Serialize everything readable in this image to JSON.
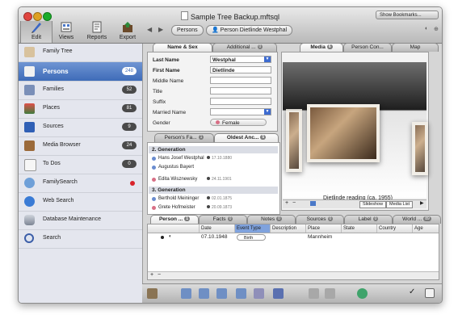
{
  "window": {
    "title": "Sample Tree Backup.mftsql",
    "show_bookmarks": "Show Bookmarks..."
  },
  "toolbar": [
    {
      "label": "Edit",
      "icon": "pen-icon"
    },
    {
      "label": "Views",
      "icon": "views-icon"
    },
    {
      "label": "Reports",
      "icon": "reports-icon"
    },
    {
      "label": "Export",
      "icon": "export-icon"
    }
  ],
  "breadcrumb": {
    "root": "Persons",
    "current": "Person Dietlinde Westphal"
  },
  "sidebar": {
    "items": [
      {
        "label": "Family Tree",
        "count": ""
      },
      {
        "label": "Persons",
        "count": "248"
      },
      {
        "label": "Families",
        "count": "52"
      },
      {
        "label": "Places",
        "count": "81"
      },
      {
        "label": "Sources",
        "count": "9"
      },
      {
        "label": "Media Browser",
        "count": "24"
      },
      {
        "label": "To Dos",
        "count": "0"
      },
      {
        "label": "FamilySearch",
        "count": ""
      },
      {
        "label": "Web Search",
        "count": ""
      },
      {
        "label": "Database Maintenance",
        "count": ""
      },
      {
        "label": "Search",
        "count": ""
      }
    ]
  },
  "name_panel": {
    "tabs": {
      "name_sex": "Name & Sex",
      "additional": "Additional ...",
      "additional_badge": "0"
    },
    "fields": {
      "last_name_label": "Last Name",
      "last_name": "Westphal",
      "first_name_label": "First Name",
      "first_name": "Dietlinde",
      "middle_name_label": "Middle Name",
      "title_label": "Title",
      "suffix_label": "Suffix",
      "married_name_label": "Married Name",
      "gender_label": "Gender",
      "gender": "Female"
    }
  },
  "ancestors_panel": {
    "tabs": {
      "persons_fa": "Person's Fa...",
      "persons_fa_badge": "1",
      "oldest_anc": "Oldest Anc...",
      "oldest_anc_badge": "5"
    },
    "gen2_header": "2. Generation",
    "gen2": [
      {
        "name": "Hans Josef Westphal",
        "date": "17.10.1880"
      },
      {
        "name": "Augustus Bayert",
        "date": ""
      },
      {
        "name": "Edita Wisznewsky",
        "date": "24.11.1901"
      }
    ],
    "gen3_header": "3. Generation",
    "gen3": [
      {
        "name": "Berthold Meininger",
        "date": "02.01.1875"
      },
      {
        "name": "Grete Hofmeister",
        "date": "20.09.1873"
      }
    ]
  },
  "media_panel": {
    "tabs": {
      "media": "Media",
      "media_badge": "6",
      "person_con": "Person Con...",
      "map": "Map"
    },
    "caption": "Dietlinde reading (ca. 1955)",
    "slideshow": "Slideshow",
    "media_list": "Media List"
  },
  "events_panel": {
    "tabs": [
      {
        "label": "Person ...",
        "badge": "1"
      },
      {
        "label": "Facts",
        "badge": "0"
      },
      {
        "label": "Notes",
        "badge": "0"
      },
      {
        "label": "Sources",
        "badge": "0"
      },
      {
        "label": "Label",
        "badge": "0"
      },
      {
        "label": "World ...",
        "badge": "89"
      }
    ],
    "columns": {
      "date": "Date",
      "event_type": "Event Type",
      "description": "Description",
      "place": "Place",
      "state": "State",
      "country": "Country",
      "age": "Age"
    },
    "rows": [
      {
        "date": "07.10.1948",
        "event_type": "Birth",
        "description": "",
        "place": "Mannheim",
        "state": "",
        "country": "",
        "age": ""
      }
    ]
  },
  "colors": {
    "selection": "#3e6bb8",
    "sidebar_bg": "#e4e6ee"
  }
}
